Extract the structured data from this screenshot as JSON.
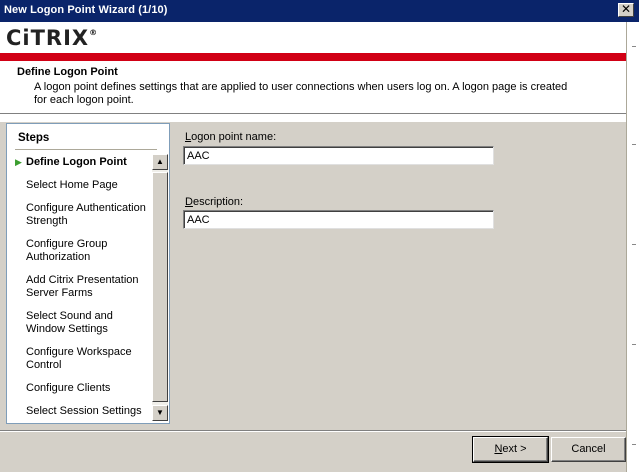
{
  "window": {
    "title": "New Logon Point Wizard (1/10)",
    "close_glyph": "✕"
  },
  "header": {
    "logo_text": "CiTRIX",
    "logo_mark": "®",
    "section_title": "Define Logon Point",
    "section_desc": "A logon point defines settings that are applied to user connections when users log on. A logon page is created for each logon point."
  },
  "steps": {
    "heading": "Steps",
    "active_marker": "▶",
    "items": [
      {
        "label": "Define Logon Point",
        "active": true
      },
      {
        "label": "Select Home Page"
      },
      {
        "label": "Configure Authentication Strength"
      },
      {
        "label": "Configure Group Authorization"
      },
      {
        "label": "Add Citrix Presentation Server Farms"
      },
      {
        "label": "Select Sound and Window Settings"
      },
      {
        "label": "Configure Workspace Control"
      },
      {
        "label": "Configure Clients"
      },
      {
        "label": "Select Session Settings"
      }
    ]
  },
  "form": {
    "name_label_prefix": "",
    "name_label_mnemonic": "L",
    "name_label_rest": "ogon point name:",
    "name_value": "AAC",
    "desc_label_mnemonic": "D",
    "desc_label_rest": "escription:",
    "desc_value": "AAC"
  },
  "footer": {
    "next_mnemonic": "N",
    "next_rest": "ext >",
    "cancel_label": "Cancel"
  },
  "scrollbar": {
    "up_glyph": "▲",
    "down_glyph": "▼"
  }
}
